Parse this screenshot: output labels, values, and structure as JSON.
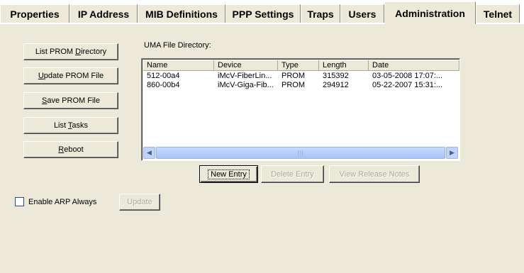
{
  "tabs": [
    {
      "label": "Properties"
    },
    {
      "label": "IP Address"
    },
    {
      "label": "MIB Definitions"
    },
    {
      "label": "PPP Settings"
    },
    {
      "label": "Traps"
    },
    {
      "label": "Users"
    },
    {
      "label": "Administration",
      "active": true
    },
    {
      "label": "Telnet"
    }
  ],
  "side_buttons": {
    "list_prom_directory": {
      "before": "List PROM ",
      "mnemonic": "D",
      "after": "irectory"
    },
    "update_prom_file": {
      "before": "",
      "mnemonic": "U",
      "after": "pdate PROM File"
    },
    "save_prom_file": {
      "before": "",
      "mnemonic": "S",
      "after": "ave PROM File"
    },
    "list_tasks": {
      "before": "List ",
      "mnemonic": "T",
      "after": "asks"
    },
    "reboot": {
      "before": "",
      "mnemonic": "R",
      "after": "eboot"
    }
  },
  "directory": {
    "label": "UMA File Directory:",
    "columns": [
      "Name",
      "Device",
      "Type",
      "Length",
      "Date"
    ],
    "rows": [
      [
        "512-00a4",
        "iMcV-FiberLin...",
        "PROM",
        "315392",
        "03-05-2008 17:07:..."
      ],
      [
        "860-00b4",
        "iMcV-Giga-Fib...",
        "PROM",
        "294912",
        "05-22-2007 15:31:..."
      ]
    ]
  },
  "entry_buttons": {
    "new_entry": "New Entry",
    "delete_entry": "Delete Entry",
    "view_release_notes": "View Release Notes"
  },
  "arp": {
    "checkbox_label": "Enable ARP Always",
    "checked": false,
    "update_label": "Update"
  },
  "icons": {
    "scroll_left": "arrow-left",
    "scroll_right": "arrow-right"
  }
}
